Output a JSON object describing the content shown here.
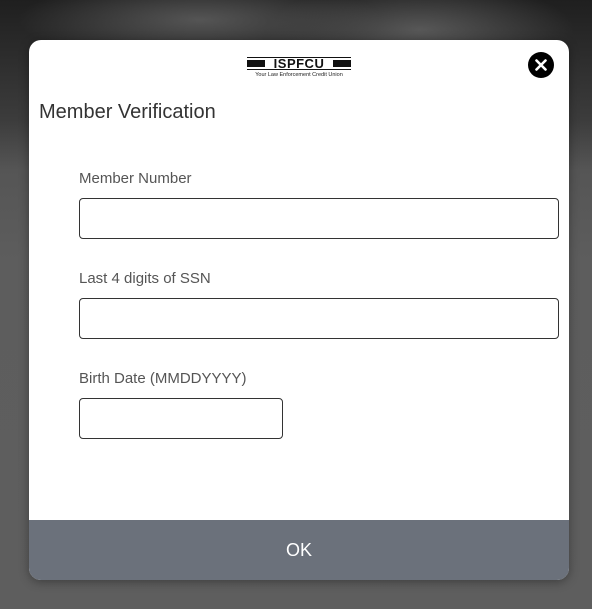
{
  "logo": {
    "name": "ISPFCU",
    "tagline": "Your Law Enforcement Credit Union"
  },
  "dialog": {
    "title": "Member Verification",
    "close_icon": "close-icon"
  },
  "form": {
    "member_number": {
      "label": "Member Number",
      "value": ""
    },
    "ssn_last4": {
      "label": "Last 4 digits of SSN",
      "value": ""
    },
    "birth_date": {
      "label": "Birth Date (MMDDYYYY)",
      "value": ""
    }
  },
  "actions": {
    "ok_label": "OK"
  },
  "colors": {
    "ok_button_bg": "#6b717b",
    "overlay": "#5e5e5e"
  }
}
